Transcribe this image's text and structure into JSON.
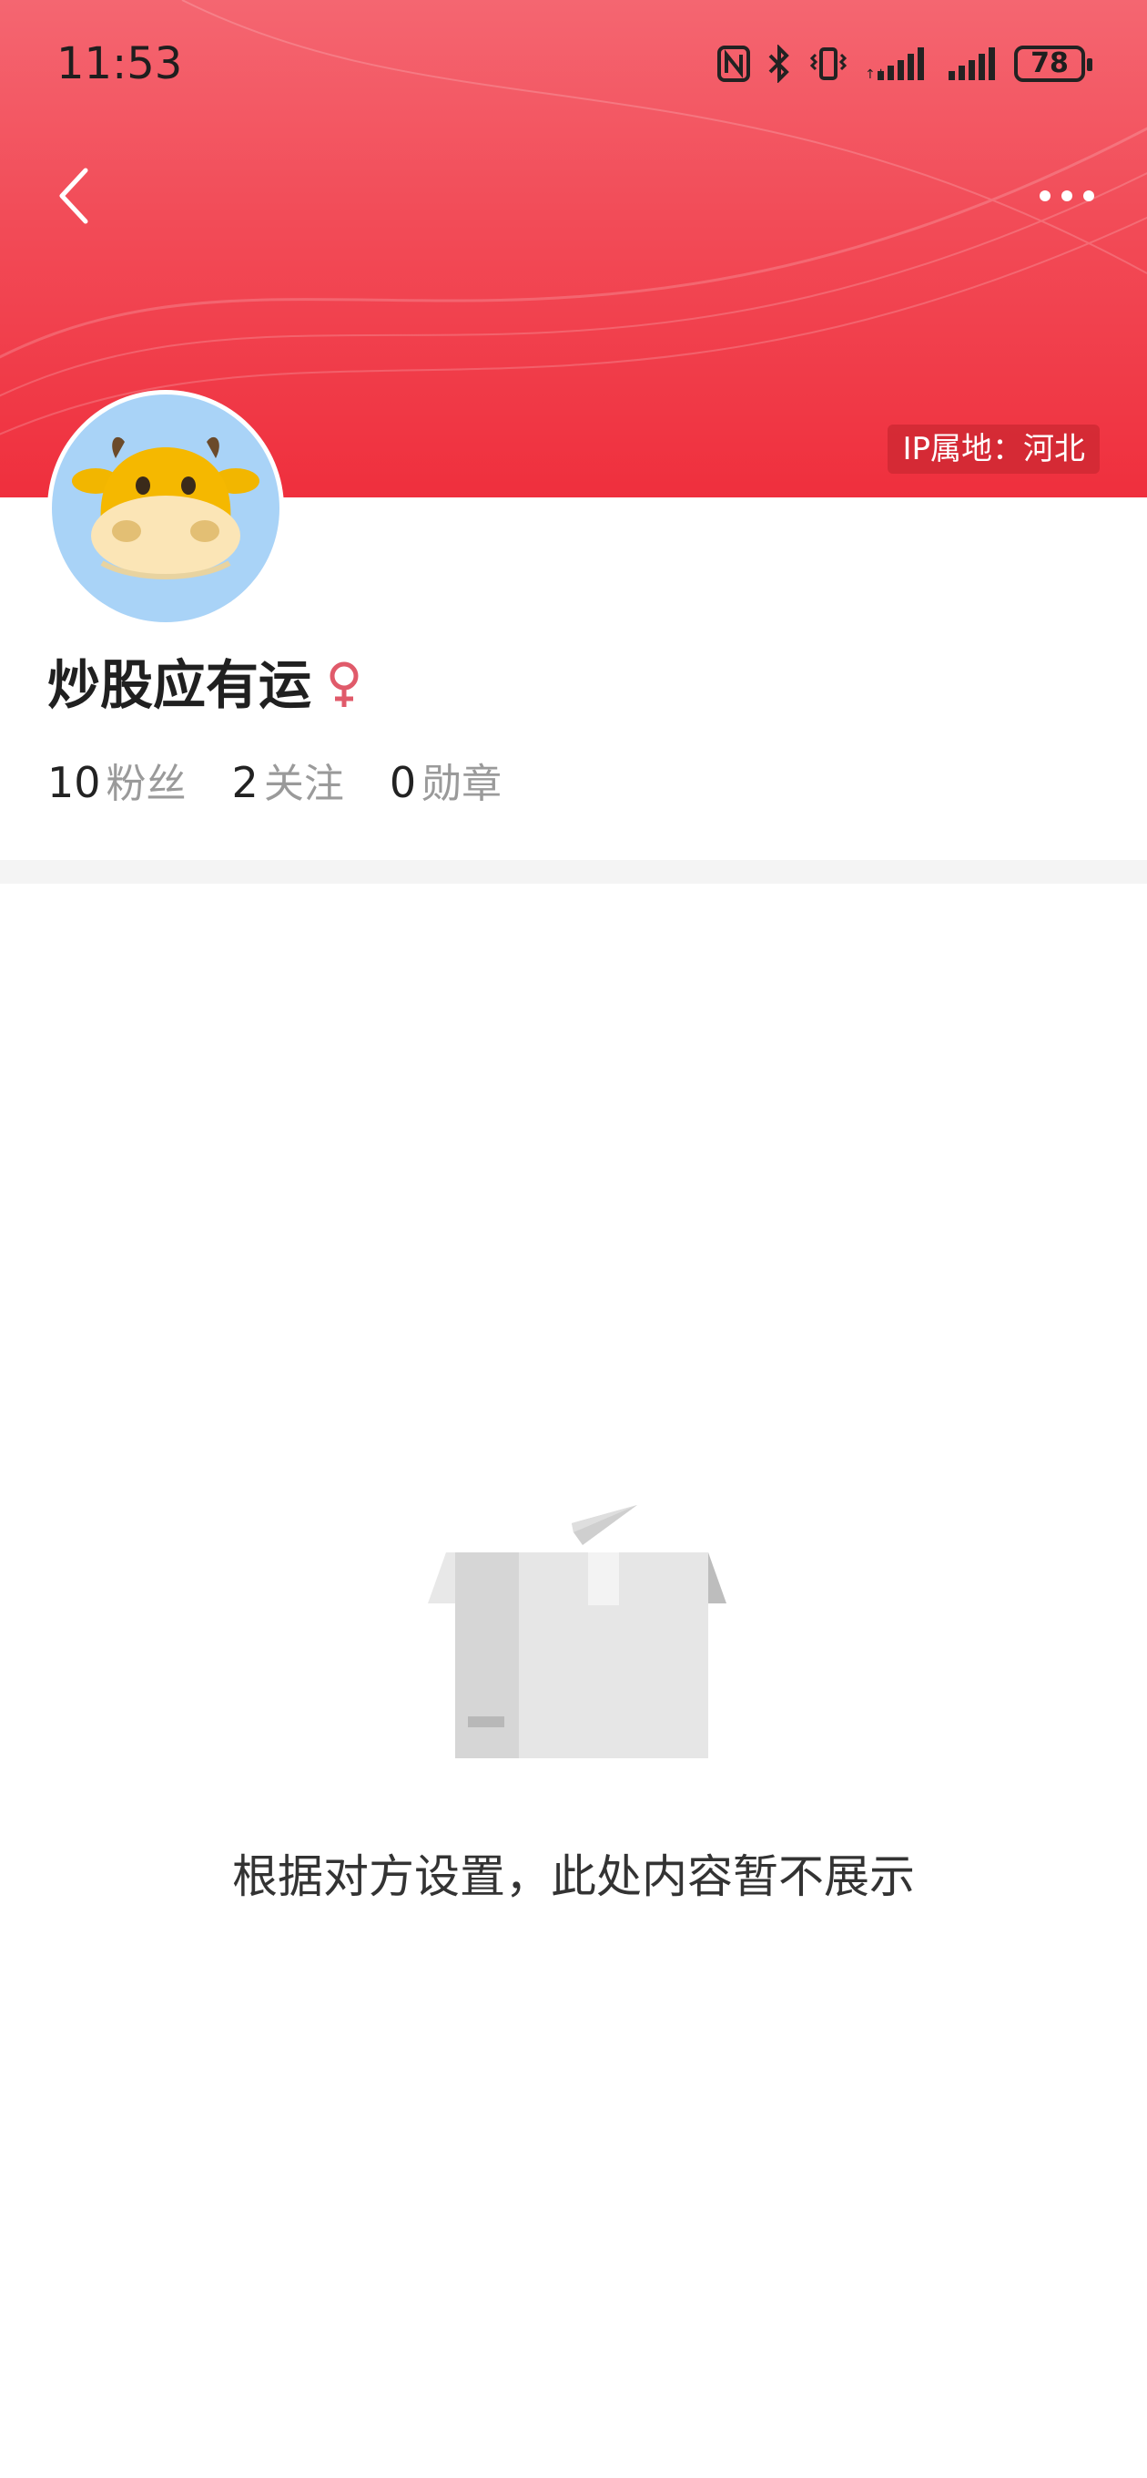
{
  "status_bar": {
    "time": "11:53",
    "battery": "78"
  },
  "header": {
    "ip_location": "IP属地：河北"
  },
  "profile": {
    "nickname": "炒股应有运",
    "gender_icon": "female-icon",
    "stats": [
      {
        "value": "10",
        "label": "粉丝"
      },
      {
        "value": "2",
        "label": "关注"
      },
      {
        "value": "0",
        "label": "勋章"
      }
    ]
  },
  "empty_state": {
    "message": "根据对方设置，此处内容暂不展示",
    "icon": "empty-box-icon"
  },
  "colors": {
    "header_red": "#f24b57",
    "avatar_bg": "#a9d3f7",
    "female_icon": "#e05a6a"
  }
}
